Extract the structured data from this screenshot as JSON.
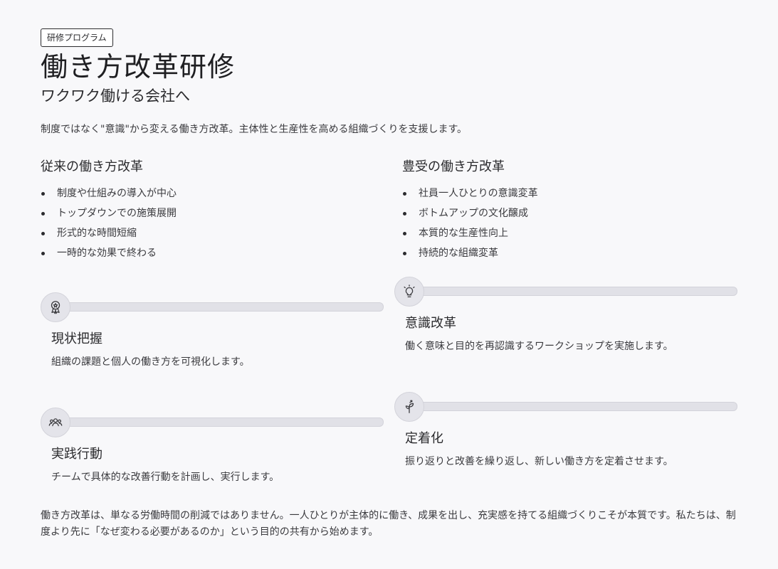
{
  "tag": "研修プログラム",
  "title": "働き方改革研修",
  "subtitle": "ワクワク働ける会社へ",
  "intro": "制度ではなく\"意識\"から変える働き方改革。主体性と生産性を高める組織づくりを支援します。",
  "comparison": {
    "left": {
      "heading": "従来の働き方改革",
      "items": [
        "制度や仕組みの導入が中心",
        "トップダウンでの施策展開",
        "形式的な時間短縮",
        "一時的な効果で終わる"
      ]
    },
    "right": {
      "heading": "豊受の働き方改革",
      "items": [
        "社員一人ひとりの意識変革",
        "ボトムアップの文化醸成",
        "本質的な生産性向上",
        "持続的な組織変革"
      ]
    }
  },
  "steps": [
    {
      "icon": "award-icon",
      "title": "現状把握",
      "description": "組織の課題と個人の働き方を可視化します。"
    },
    {
      "icon": "lightbulb-icon",
      "title": "意識改革",
      "description": "働く意味と目的を再認識するワークショップを実施します。"
    },
    {
      "icon": "users-icon",
      "title": "実践行動",
      "description": "チームで具体的な改善行動を計画し、実行します。"
    },
    {
      "icon": "sprout-icon",
      "title": "定着化",
      "description": "振り返りと改善を繰り返し、新しい働き方を定着させます。"
    }
  ],
  "closing": "働き方改革は、単なる労働時間の削減ではありません。一人ひとりが主体的に働き、成果を出し、充実感を持てる組織づくりこそが本質です。私たちは、制度より先に「なぜ変わる必要があるのか」という目的の共有から始めます。"
}
